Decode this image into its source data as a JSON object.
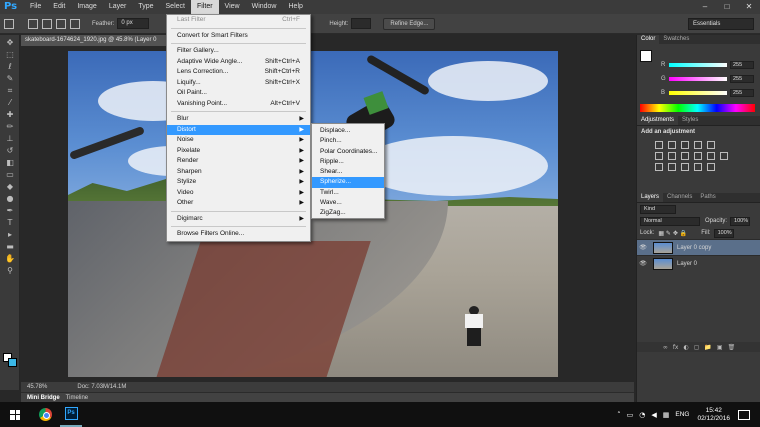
{
  "app": {
    "logo": "Ps",
    "menus": [
      "File",
      "Edit",
      "Image",
      "Layer",
      "Type",
      "Select",
      "Filter",
      "View",
      "Window",
      "Help"
    ],
    "active_menu": "Filter",
    "window_controls": [
      "–",
      "□",
      "✕"
    ]
  },
  "options_bar": {
    "feather_label": "Feather:",
    "feather_value": "0 px",
    "height_label": "Height:",
    "refine_edge": "Refine Edge...",
    "workspace": "Essentials"
  },
  "document": {
    "tab_title": "skateboard-1674624_1920.jpg @ 45.8% (Layer 0",
    "zoom": "45.78%",
    "doc_size": "Doc: 7.03M/14.1M"
  },
  "bottom_tabs": [
    "Mini Bridge",
    "Timeline"
  ],
  "filter_menu": {
    "items": [
      {
        "label": "Last Filter",
        "shortcut": "Ctrl+F",
        "disabled": true
      },
      {
        "sep": true
      },
      {
        "label": "Convert for Smart Filters"
      },
      {
        "sep": true
      },
      {
        "label": "Filter Gallery..."
      },
      {
        "label": "Adaptive Wide Angle...",
        "shortcut": "Shift+Ctrl+A"
      },
      {
        "label": "Lens Correction...",
        "shortcut": "Shift+Ctrl+R"
      },
      {
        "label": "Liquify...",
        "shortcut": "Shift+Ctrl+X"
      },
      {
        "label": "Oil Paint..."
      },
      {
        "label": "Vanishing Point...",
        "shortcut": "Alt+Ctrl+V"
      },
      {
        "sep": true
      },
      {
        "label": "Blur",
        "submenu": true
      },
      {
        "label": "Distort",
        "submenu": true,
        "highlighted": true
      },
      {
        "label": "Noise",
        "submenu": true
      },
      {
        "label": "Pixelate",
        "submenu": true
      },
      {
        "label": "Render",
        "submenu": true
      },
      {
        "label": "Sharpen",
        "submenu": true
      },
      {
        "label": "Stylize",
        "submenu": true
      },
      {
        "label": "Video",
        "submenu": true
      },
      {
        "label": "Other",
        "submenu": true
      },
      {
        "sep": true
      },
      {
        "label": "Digimarc",
        "submenu": true
      },
      {
        "sep": true
      },
      {
        "label": "Browse Filters Online..."
      }
    ]
  },
  "distort_submenu": {
    "items": [
      "Displace...",
      "Pinch...",
      "Polar Coordinates...",
      "Ripple...",
      "Shear...",
      "Spherize...",
      "Twirl...",
      "Wave...",
      "ZigZag..."
    ],
    "highlighted": "Spherize..."
  },
  "color_panel": {
    "tabs": [
      "Color",
      "Swatches"
    ],
    "channels": [
      {
        "label": "R",
        "value": "255"
      },
      {
        "label": "G",
        "value": "255"
      },
      {
        "label": "B",
        "value": "255"
      }
    ]
  },
  "adjustments_panel": {
    "tabs": [
      "Adjustments",
      "Styles"
    ],
    "title": "Add an adjustment"
  },
  "layers_panel": {
    "tabs": [
      "Layers",
      "Channels",
      "Paths"
    ],
    "kind_label": "Kind",
    "blend_mode": "Normal",
    "opacity_label": "Opacity:",
    "opacity_value": "100%",
    "lock_label": "Lock:",
    "fill_label": "Fill:",
    "fill_value": "100%",
    "layers": [
      {
        "name": "Layer 0 copy",
        "selected": true
      },
      {
        "name": "Layer 0",
        "selected": false
      }
    ],
    "footer_icons": [
      "∞",
      "fx",
      "◐",
      "▢",
      "📁",
      "▣",
      "🗑"
    ]
  },
  "taskbar": {
    "lang": "ENG",
    "time": "15:42",
    "date": "02/12/2016"
  }
}
